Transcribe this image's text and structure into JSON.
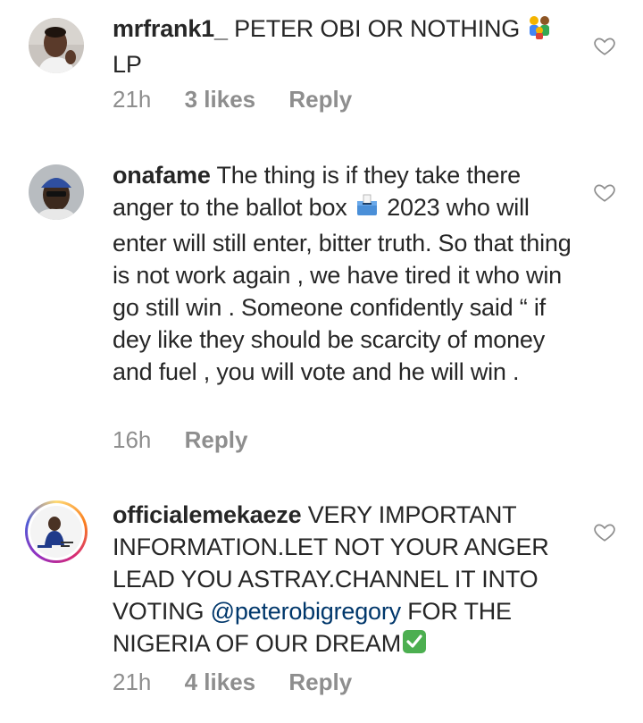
{
  "comments": [
    {
      "username": "mrfrank1_",
      "text_line1": " PETER OBI OR NOTHING ",
      "text_line2": "LP",
      "emoji": "family-emoji",
      "time": "21h",
      "likes": "3 likes",
      "reply": "Reply"
    },
    {
      "username": "onafame",
      "text_part1": " The thing is if they take there anger to the ballot box ",
      "text_part2": " 2023 who will enter will still enter, bitter truth. So that thing is not work again , we have tired it who win go still win .  Someone confidently said “ if dey like they should be scarcity of money and fuel , you will vote and he will win .",
      "emoji": "ballot-box-emoji",
      "time": "16h",
      "reply": "Reply"
    },
    {
      "username": "officialemekaeze",
      "text_part1": " VERY IMPORTANT INFORMATION.LET NOT YOUR ANGER LEAD YOU ASTRAY.CHANNEL IT  INTO VOTING ",
      "mention": "@peterobigregory",
      "text_part2": " FOR THE NIGERIA OF OUR DREAM",
      "emoji": "check-mark-emoji",
      "time": "21h",
      "likes": "4 likes",
      "reply": "Reply"
    }
  ],
  "colors": {
    "text": "#262626",
    "meta": "#8e8e8e",
    "mention": "#00376b",
    "check": "#4caf50"
  }
}
